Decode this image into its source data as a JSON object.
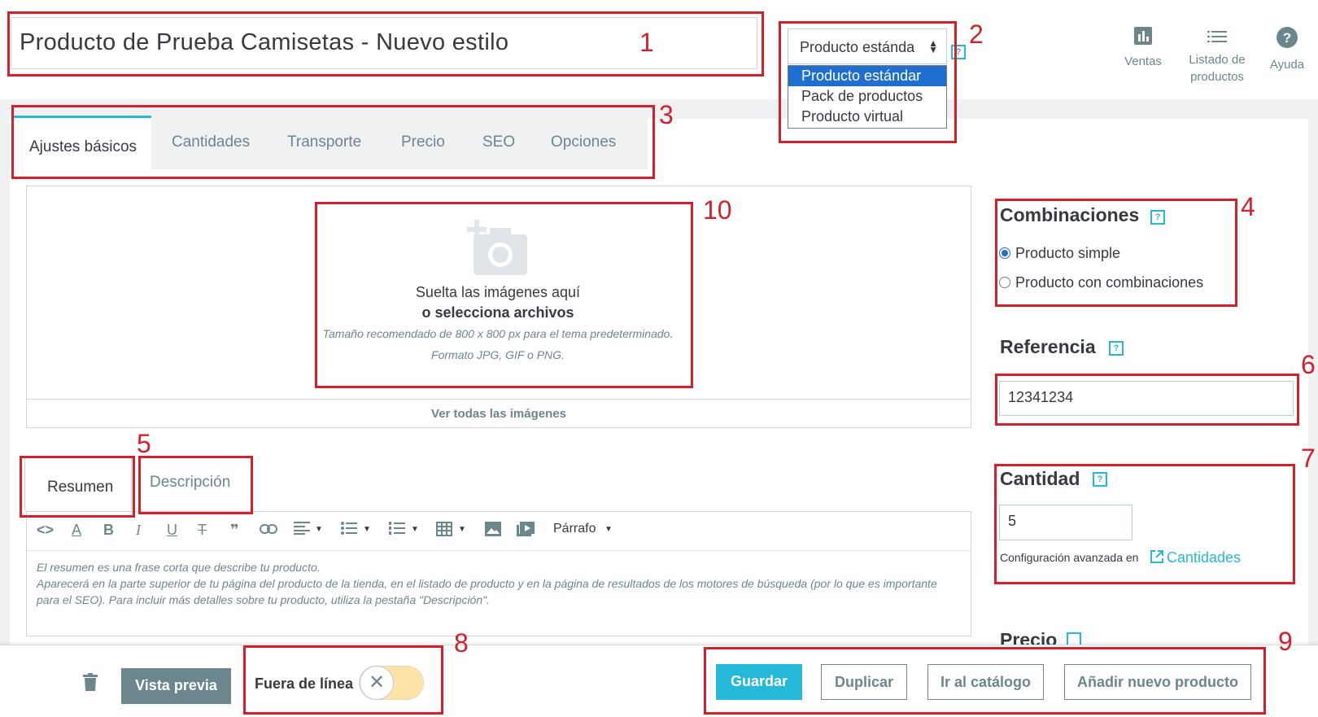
{
  "header": {
    "product_name": "Producto de Prueba Camisetas - Nuevo estilo",
    "type_selected": "Producto estánda",
    "type_options": [
      "Producto estándar",
      "Pack de productos",
      "Producto virtual"
    ],
    "help_mark": "?",
    "nav": [
      {
        "label": "Ventas",
        "icon": "chart-icon"
      },
      {
        "label": "Listado de productos",
        "icon": "list-icon"
      },
      {
        "label": "Ayuda",
        "icon": "help-icon"
      }
    ]
  },
  "tabs": [
    "Ajustes básicos",
    "Cantidades",
    "Transporte",
    "Precio",
    "SEO",
    "Opciones"
  ],
  "images": {
    "drop_line1": "Suelta las imágenes aquí",
    "drop_line2": "o selecciona archivos",
    "hint1": "Tamaño recomendado de 800 x 800 px para el tema predeterminado.",
    "hint2": "Formato JPG, GIF o PNG.",
    "view_all": "Ver todas las imágenes"
  },
  "text_tabs": [
    "Resumen",
    "Descripción"
  ],
  "editor": {
    "format_label": "Párrafo",
    "placeholder_line1": "El resumen es una frase corta que describe tu producto.",
    "placeholder_line2": "Aparecerá en la parte superior de tu página del producto de la tienda, en el listado de producto y en la página de resultados de los motores de búsqueda (por lo que es importante para el SEO). Para incluir más detalles sobre tu producto, utiliza la pestaña \"Descripción\"."
  },
  "sidebar": {
    "combinations_title": "Combinaciones",
    "option_simple": "Producto simple",
    "option_combinations": "Producto con combinaciones",
    "selected_option": "Producto simple",
    "reference_title": "Referencia",
    "reference_value": "12341234",
    "quantity_title": "Cantidad",
    "quantity_value": "5",
    "advanced_text": "Configuración avanzada en",
    "advanced_link": "Cantidades",
    "price_title": "Precio"
  },
  "footer": {
    "preview": "Vista previa",
    "offline_label": "Fuera de línea",
    "offline_enabled": false,
    "save": "Guardar",
    "duplicate": "Duplicar",
    "catalog": "Ir al catálogo",
    "add_new": "Añadir nuevo producto"
  },
  "callouts": [
    "1",
    "2",
    "3",
    "4",
    "5",
    "6",
    "7",
    "8",
    "9",
    "10"
  ],
  "colors": {
    "accent": "#25b9d7",
    "annotation": "#d4202a",
    "select_highlight": "#1e6fd0",
    "toggle_off": "#fde3a7"
  }
}
